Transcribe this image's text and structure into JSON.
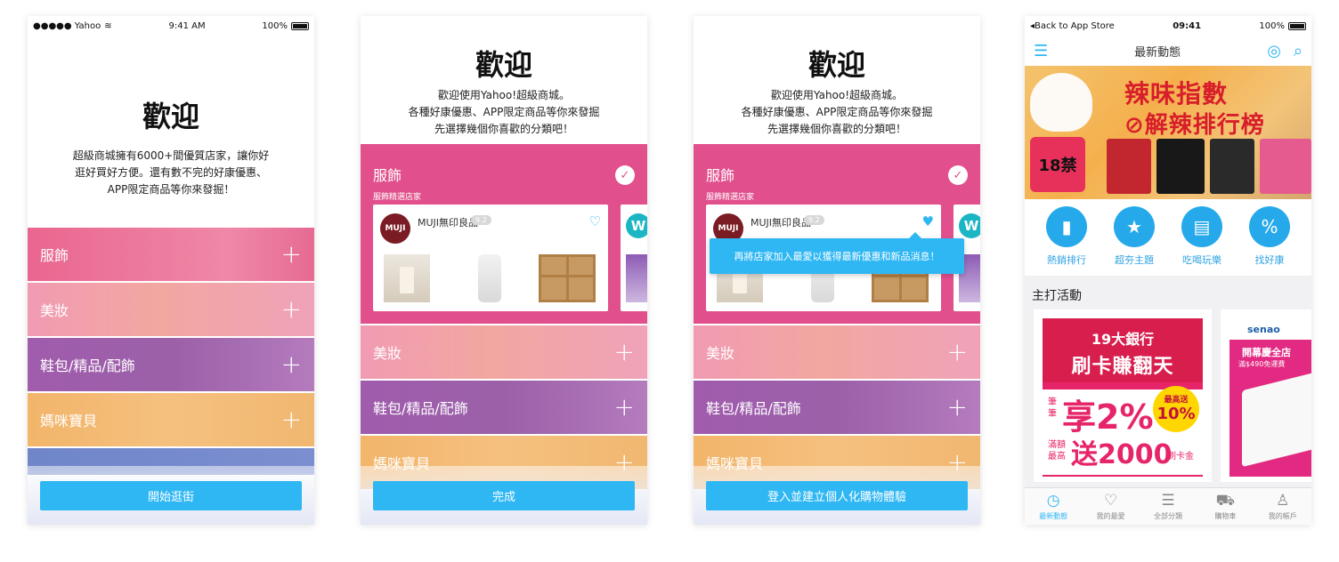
{
  "screen1": {
    "status": {
      "carrier": "●●●●● Yahoo",
      "time": "9:41 AM",
      "battery": "100%"
    },
    "title": "歡迎",
    "text_lines": [
      "超級商城擁有6000+間優質店家，讓你好",
      "逛好買好方便。還有數不完的好康優惠、",
      "APP限定商品等你來發掘！"
    ],
    "categories": [
      {
        "label": "服飾",
        "action": "+"
      },
      {
        "label": "美妝",
        "action": "+"
      },
      {
        "label": "鞋包/精品/配飾",
        "action": "+"
      },
      {
        "label": "媽咪寶貝",
        "action": "+"
      }
    ],
    "button": "開始逛街"
  },
  "screen2": {
    "title": "歡迎",
    "text_lines": [
      "歡迎使用Yahoo!超級商城。",
      "各種好康優惠、APP限定商品等你來發掘",
      "先選擇幾個你喜歡的分類吧！"
    ],
    "expanded": {
      "label": "服飾",
      "check": "✓",
      "subtitle": "服飾精選店家",
      "store": {
        "logo": "MUJI",
        "name": "MUJI無印良品",
        "rating": "9.2",
        "heart": "♡"
      },
      "store2_logo": "W"
    },
    "categories": [
      {
        "label": "美妝",
        "action": "+"
      },
      {
        "label": "鞋包/精品/配飾",
        "action": "+"
      },
      {
        "label": "媽咪寶貝",
        "action": "+"
      }
    ],
    "button": "完成"
  },
  "screen3": {
    "title": "歡迎",
    "text_lines": [
      "歡迎使用Yahoo!超級商城。",
      "各種好康優惠、APP限定商品等你來發掘",
      "先選擇幾個你喜歡的分類吧！"
    ],
    "expanded": {
      "label": "服飾",
      "check": "✓",
      "subtitle": "服飾精選店家",
      "store": {
        "logo": "MUJI",
        "name": "MUJI無印良品",
        "rating": "9.2",
        "heart": "♥"
      },
      "store2_logo": "W"
    },
    "tooltip": "再將店家加入最愛以獲得最新優惠和新品消息！",
    "categories": [
      {
        "label": "美妝",
        "action": "+"
      },
      {
        "label": "鞋包/精品/配飾",
        "action": "+"
      },
      {
        "label": "媽咪寶貝",
        "action": "+"
      }
    ],
    "button": "登入並建立個人化購物體驗"
  },
  "screen4": {
    "status": {
      "back": "◂Back to App Store",
      "time": "09:41",
      "battery": "100%"
    },
    "nav": {
      "title": "最新動態",
      "menu_icon": "☰",
      "camera_icon": "◎",
      "search_icon": "⌕"
    },
    "banner": {
      "line1": "辣味指數",
      "line2": "⊘解辣排行榜",
      "badge": "18禁"
    },
    "quick_links": [
      {
        "label": "熱銷排行",
        "icon": "bar-chart-icon",
        "glyph": "▮"
      },
      {
        "label": "超夯主題",
        "icon": "star-icon",
        "glyph": "★"
      },
      {
        "label": "吃喝玩樂",
        "icon": "ticket-icon",
        "glyph": "▤"
      },
      {
        "label": "找好康",
        "icon": "tag-icon",
        "glyph": "%"
      }
    ],
    "section_title": "主打活動",
    "promo": {
      "line1": "19大銀行",
      "line2": "刷卡賺翻天",
      "label_a": "筆筆",
      "big": "享2%",
      "badge_top": "最高送",
      "badge_value": "10%",
      "label_b": "滿額最高",
      "big2": "送2000",
      "suffix": "刷卡金"
    },
    "promo2": {
      "logo": "senao",
      "title": "開幕慶全店",
      "sub": "滿$490免運費"
    },
    "tabs": [
      {
        "label": "最新動態",
        "glyph": "◷",
        "active": true
      },
      {
        "label": "我的最愛",
        "glyph": "♡",
        "active": false
      },
      {
        "label": "全部分類",
        "glyph": "☰",
        "active": false
      },
      {
        "label": "購物車",
        "glyph": "⛟",
        "active": false
      },
      {
        "label": "我的帳戶",
        "glyph": "♙",
        "active": false
      }
    ]
  },
  "colors": {
    "accent": "#2fb7f4",
    "fashion": "#e1508d"
  }
}
